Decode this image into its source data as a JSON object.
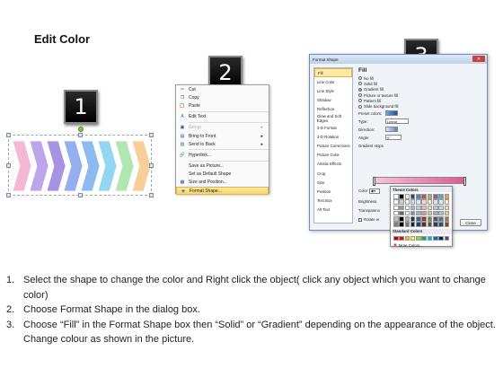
{
  "title": "Edit Color",
  "badges": [
    "1",
    "2",
    "3"
  ],
  "shape": {
    "colors": [
      "#f4b0cf",
      "#b79ae8",
      "#9f86e0",
      "#8aa5ee",
      "#7fb4ef",
      "#86d1f0",
      "#a7e3a9",
      "#f7c98f"
    ]
  },
  "context_menu": {
    "items": [
      {
        "label": "Cut",
        "icon": "✂",
        "disabled": false,
        "arrow": false
      },
      {
        "label": "Copy",
        "icon": "❐",
        "disabled": false,
        "arrow": false
      },
      {
        "label": "Paste",
        "icon": "📋",
        "disabled": false,
        "arrow": false
      },
      {
        "sep": true
      },
      {
        "label": "Edit Text",
        "icon": "A",
        "disabled": false,
        "arrow": false
      },
      {
        "sep": true
      },
      {
        "label": "Group",
        "icon": "▣",
        "disabled": true,
        "arrow": true
      },
      {
        "label": "Bring to Front",
        "icon": "▤",
        "disabled": false,
        "arrow": true
      },
      {
        "label": "Send to Back",
        "icon": "▥",
        "disabled": false,
        "arrow": true
      },
      {
        "sep": true
      },
      {
        "label": "Hyperlink...",
        "icon": "🔗",
        "disabled": false,
        "arrow": false
      },
      {
        "sep": true
      },
      {
        "label": "Save as Picture...",
        "icon": "",
        "disabled": false,
        "arrow": false
      },
      {
        "label": "Set as Default Shape",
        "icon": "",
        "disabled": false,
        "arrow": false
      },
      {
        "label": "Size and Position...",
        "icon": "▦",
        "disabled": false,
        "arrow": false
      },
      {
        "label": "Format Shape...",
        "icon": "◈",
        "disabled": false,
        "arrow": false,
        "highlight": true
      }
    ]
  },
  "dialog": {
    "title": "Format Shape",
    "close_x": "✕",
    "nav": [
      "Fill",
      "Line Color",
      "Line Style",
      "Shadow",
      "Reflection",
      "Glow and Soft Edges",
      "3-D Format",
      "3-D Rotation",
      "Picture Corrections",
      "Picture Color",
      "Artistic Effects",
      "Crop",
      "Size",
      "Position",
      "Text Box",
      "Alt Text"
    ],
    "section": "Fill",
    "options": [
      {
        "label": "No fill",
        "on": false
      },
      {
        "label": "Solid fill",
        "on": false
      },
      {
        "label": "Gradient fill",
        "on": true
      },
      {
        "label": "Picture or texture fill",
        "on": false
      },
      {
        "label": "Pattern fill",
        "on": false
      },
      {
        "label": "Slide background fill",
        "on": false
      }
    ],
    "preset_label": "Preset colors:",
    "type_label": "Type:",
    "type_value": "Linear",
    "direction_label": "Direction:",
    "angle_label": "Angle:",
    "angle_value": "0°",
    "stops_label": "Gradient stops",
    "color_label": "Color",
    "position_label": "Position:",
    "position_value": "0%",
    "brightness_label": "Brightness",
    "transparency_label": "Transparenc",
    "rotate_label": "Rotate w",
    "close_button": "Close"
  },
  "picker": {
    "theme_label": "Theme Colors",
    "standard_label": "Standard Colors",
    "more_label": "More Colors...",
    "theme_top": [
      "#ffffff",
      "#000000",
      "#eeece1",
      "#1f497d",
      "#4f81bd",
      "#c0504d",
      "#9bbb59",
      "#8064a2",
      "#4bacc6",
      "#f79646"
    ],
    "standard": [
      "#c00000",
      "#ff0000",
      "#ffc000",
      "#ffff00",
      "#92d050",
      "#00b050",
      "#00b0f0",
      "#0070c0",
      "#002060",
      "#7030a0"
    ]
  },
  "instructions": [
    {
      "num": "1.",
      "text": "Select the shape to change the color and Right click the object( click any object which you want to change color)"
    },
    {
      "num": "2.",
      "text": "Choose Format Shape in the dialog box."
    },
    {
      "num": "3.",
      "text": "Choose “Fill” in the Format Shape box then “Solid” or “Gradient” depending on the appearance of the object. Change colour as shown in the picture."
    }
  ]
}
